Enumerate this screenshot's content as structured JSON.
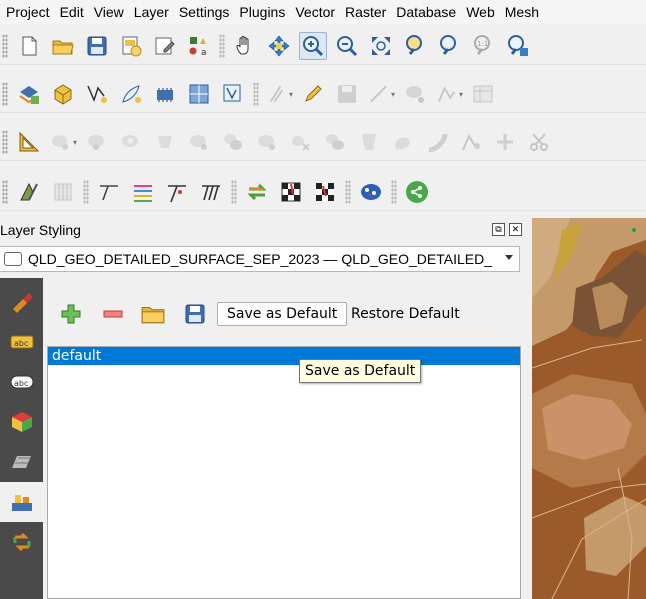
{
  "menubar": {
    "items": [
      "Project",
      "Edit",
      "View",
      "Layer",
      "Settings",
      "Plugins",
      "Vector",
      "Raster",
      "Database",
      "Web",
      "Mesh"
    ]
  },
  "toolbar1": {
    "icons": [
      "new-project-icon",
      "open-project-icon",
      "save-project-icon",
      "new-print-layout-icon",
      "layout-manager-icon",
      "style-manager-icon",
      "pan-icon",
      "pan-to-selection-icon",
      "zoom-in-icon",
      "zoom-out-icon",
      "zoom-full-icon",
      "zoom-to-selection-icon",
      "zoom-to-layer-icon",
      "zoom-native-icon",
      "zoom-last-icon"
    ],
    "active": "zoom-in-icon"
  },
  "toolbar2": {
    "icons": [
      "data-source-manager-icon",
      "new-geopackage-icon",
      "new-shapefile-icon",
      "digitize-icon",
      "new-virtual-layer-icon",
      "new-mesh-layer-icon",
      "new-temp-layer-icon",
      "current-edits-icon",
      "toggle-editing-icon",
      "save-edits-icon",
      "digitize-line-icon",
      "add-feature-icon",
      "vertex-tool-icon",
      "attribute-table-icon"
    ]
  },
  "toolbar3": {
    "icons": [
      "measure-icon",
      "add-ring-icon",
      "fill-ring-icon",
      "delete-ring-icon",
      "delete-part-icon",
      "reshape-icon",
      "offset-curve-icon",
      "split-features-icon",
      "split-parts-icon",
      "merge-features-icon",
      "merge-attributes-icon",
      "rotate-symbols-icon",
      "simplify-icon",
      "add-part-icon",
      "node-tool-icon",
      "cut-icon"
    ]
  },
  "toolbar4": {
    "icons": [
      "label-tool-icon",
      "table-tool-icon",
      "snapping-line-icon",
      "snapping-multi-icon",
      "trace-icon",
      "parallel-lines-icon",
      "reverse-line-icon",
      "checkerboard-icon",
      "checkerboard-dark-icon",
      "globe-icon",
      "share-icon"
    ]
  },
  "panel": {
    "title": "Layer Styling",
    "float_glyph": "⧉",
    "close_glyph": "✕"
  },
  "layer_select": {
    "value": "QLD_GEO_DETAILED_SURFACE_SEP_2023 — QLD_GEO_DETAILED_"
  },
  "side_tabs": [
    "symbology-tab",
    "labels-tab",
    "masks-tab",
    "3d-view-tab",
    "diagrams-tab",
    "fields-tab",
    "history-tab"
  ],
  "side_tab_labels": {
    "labels": "abc",
    "masks": "abc"
  },
  "style_manager": {
    "add_label": "Add",
    "remove_label": "Remove",
    "load_label": "Load",
    "save_default_label": "Save as Default",
    "restore_default_label": "Restore Default",
    "styles": [
      "default"
    ],
    "selected": "default"
  },
  "tooltip": {
    "text": "Save as Default"
  },
  "colors": {
    "accent": "#0078d7",
    "map_dark": "#7a5236",
    "map_mid": "#9a5a2a",
    "map_light": "#c59a6b"
  }
}
